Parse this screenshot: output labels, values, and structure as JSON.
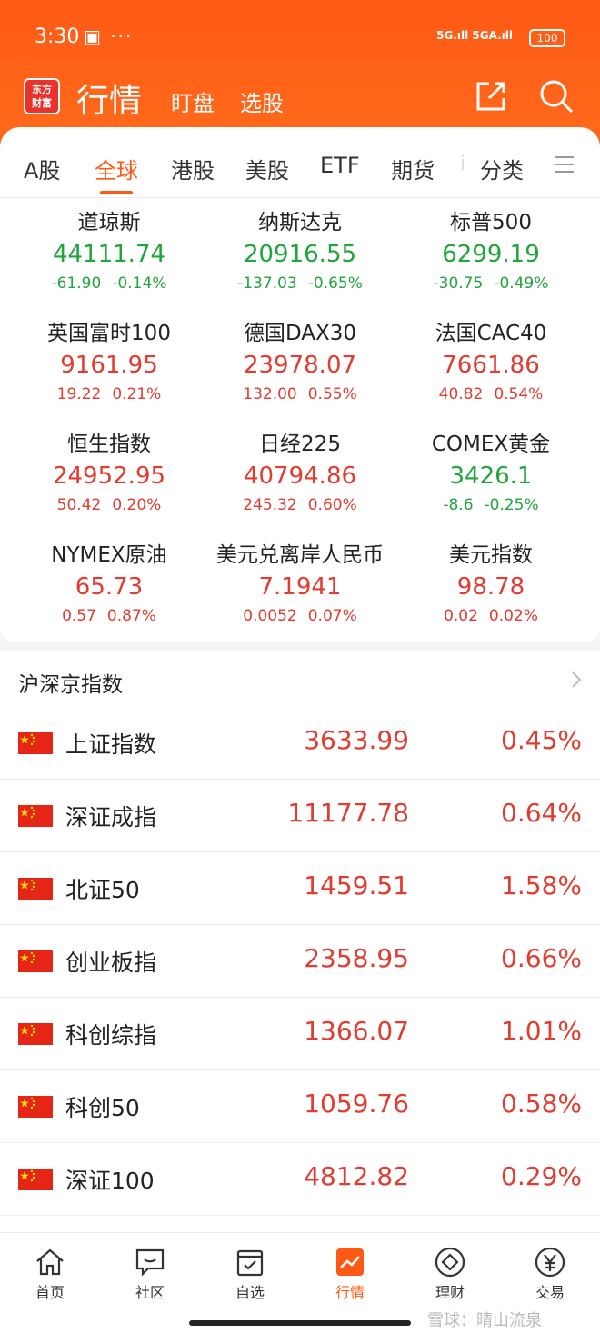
{
  "status": {
    "time": "3:30",
    "extra": "▣ ···",
    "network": "5G.ıll 5GA.ıll",
    "battery": "100"
  },
  "nav": {
    "logo_line1": "东方",
    "logo_line2": "财富",
    "title": "行情",
    "sub1": "盯盘",
    "sub2": "选股"
  },
  "tabs": [
    {
      "label": "A股"
    },
    {
      "label": "全球"
    },
    {
      "label": "港股"
    },
    {
      "label": "美股"
    },
    {
      "label": "ETF"
    },
    {
      "label": "期货"
    },
    {
      "label": "分类"
    }
  ],
  "active_tab": "全球",
  "tab_fade_glyph": "i",
  "global": [
    {
      "name": "道琼斯",
      "price": "44111.74",
      "chg": "-61.90",
      "pct": "-0.14%",
      "dir": "down"
    },
    {
      "name": "纳斯达克",
      "price": "20916.55",
      "chg": "-137.03",
      "pct": "-0.65%",
      "dir": "down"
    },
    {
      "name": "标普500",
      "price": "6299.19",
      "chg": "-30.75",
      "pct": "-0.49%",
      "dir": "down"
    },
    {
      "name": "英国富时100",
      "price": "9161.95",
      "chg": "19.22",
      "pct": "0.21%",
      "dir": "up"
    },
    {
      "name": "德国DAX30",
      "price": "23978.07",
      "chg": "132.00",
      "pct": "0.55%",
      "dir": "up"
    },
    {
      "name": "法国CAC40",
      "price": "7661.86",
      "chg": "40.82",
      "pct": "0.54%",
      "dir": "up"
    },
    {
      "name": "恒生指数",
      "price": "24952.95",
      "chg": "50.42",
      "pct": "0.20%",
      "dir": "up"
    },
    {
      "name": "日经225",
      "price": "40794.86",
      "chg": "245.32",
      "pct": "0.60%",
      "dir": "up"
    },
    {
      "name": "COMEX黄金",
      "price": "3426.1",
      "chg": "-8.6",
      "pct": "-0.25%",
      "dir": "down"
    },
    {
      "name": "NYMEX原油",
      "price": "65.73",
      "chg": "0.57",
      "pct": "0.87%",
      "dir": "up"
    },
    {
      "name": "美元兑离岸人民币",
      "price": "7.1941",
      "chg": "0.0052",
      "pct": "0.07%",
      "dir": "up"
    },
    {
      "name": "美元指数",
      "price": "98.78",
      "chg": "0.02",
      "pct": "0.02%",
      "dir": "up"
    }
  ],
  "section": {
    "title": "沪深京指数"
  },
  "indices": [
    {
      "name": "上证指数",
      "price": "3633.99",
      "pct": "0.45%"
    },
    {
      "name": "深证成指",
      "price": "11177.78",
      "pct": "0.64%"
    },
    {
      "name": "北证50",
      "price": "1459.51",
      "pct": "1.58%"
    },
    {
      "name": "创业板指",
      "price": "2358.95",
      "pct": "0.66%"
    },
    {
      "name": "科创综指",
      "price": "1366.07",
      "pct": "1.01%"
    },
    {
      "name": "科创50",
      "price": "1059.76",
      "pct": "0.58%"
    },
    {
      "name": "深证100",
      "price": "4812.82",
      "pct": "0.29%"
    }
  ],
  "bottom_nav": [
    {
      "label": "首页",
      "icon": "home-icon"
    },
    {
      "label": "社区",
      "icon": "chat-icon"
    },
    {
      "label": "自选",
      "icon": "watchlist-icon"
    },
    {
      "label": "行情",
      "icon": "chart-icon"
    },
    {
      "label": "理财",
      "icon": "diamond-icon"
    },
    {
      "label": "交易",
      "icon": "yen-icon"
    }
  ],
  "active_nav": "行情",
  "watermark": "雪球：晴山流泉",
  "colors": {
    "brand": "#ff5a14",
    "up": "#e23b30",
    "down": "#1fa53a"
  }
}
